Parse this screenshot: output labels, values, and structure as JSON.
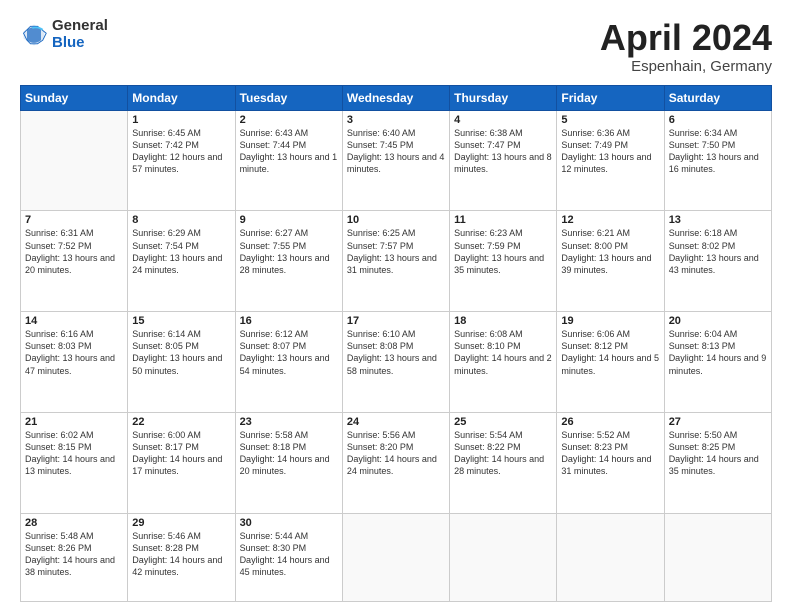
{
  "logo": {
    "general": "General",
    "blue": "Blue"
  },
  "header": {
    "title": "April 2024",
    "subtitle": "Espenhain, Germany"
  },
  "weekdays": [
    "Sunday",
    "Monday",
    "Tuesday",
    "Wednesday",
    "Thursday",
    "Friday",
    "Saturday"
  ],
  "weeks": [
    [
      {
        "day": "",
        "sunrise": "",
        "sunset": "",
        "daylight": ""
      },
      {
        "day": "1",
        "sunrise": "Sunrise: 6:45 AM",
        "sunset": "Sunset: 7:42 PM",
        "daylight": "Daylight: 12 hours and 57 minutes."
      },
      {
        "day": "2",
        "sunrise": "Sunrise: 6:43 AM",
        "sunset": "Sunset: 7:44 PM",
        "daylight": "Daylight: 13 hours and 1 minute."
      },
      {
        "day": "3",
        "sunrise": "Sunrise: 6:40 AM",
        "sunset": "Sunset: 7:45 PM",
        "daylight": "Daylight: 13 hours and 4 minutes."
      },
      {
        "day": "4",
        "sunrise": "Sunrise: 6:38 AM",
        "sunset": "Sunset: 7:47 PM",
        "daylight": "Daylight: 13 hours and 8 minutes."
      },
      {
        "day": "5",
        "sunrise": "Sunrise: 6:36 AM",
        "sunset": "Sunset: 7:49 PM",
        "daylight": "Daylight: 13 hours and 12 minutes."
      },
      {
        "day": "6",
        "sunrise": "Sunrise: 6:34 AM",
        "sunset": "Sunset: 7:50 PM",
        "daylight": "Daylight: 13 hours and 16 minutes."
      }
    ],
    [
      {
        "day": "7",
        "sunrise": "Sunrise: 6:31 AM",
        "sunset": "Sunset: 7:52 PM",
        "daylight": "Daylight: 13 hours and 20 minutes."
      },
      {
        "day": "8",
        "sunrise": "Sunrise: 6:29 AM",
        "sunset": "Sunset: 7:54 PM",
        "daylight": "Daylight: 13 hours and 24 minutes."
      },
      {
        "day": "9",
        "sunrise": "Sunrise: 6:27 AM",
        "sunset": "Sunset: 7:55 PM",
        "daylight": "Daylight: 13 hours and 28 minutes."
      },
      {
        "day": "10",
        "sunrise": "Sunrise: 6:25 AM",
        "sunset": "Sunset: 7:57 PM",
        "daylight": "Daylight: 13 hours and 31 minutes."
      },
      {
        "day": "11",
        "sunrise": "Sunrise: 6:23 AM",
        "sunset": "Sunset: 7:59 PM",
        "daylight": "Daylight: 13 hours and 35 minutes."
      },
      {
        "day": "12",
        "sunrise": "Sunrise: 6:21 AM",
        "sunset": "Sunset: 8:00 PM",
        "daylight": "Daylight: 13 hours and 39 minutes."
      },
      {
        "day": "13",
        "sunrise": "Sunrise: 6:18 AM",
        "sunset": "Sunset: 8:02 PM",
        "daylight": "Daylight: 13 hours and 43 minutes."
      }
    ],
    [
      {
        "day": "14",
        "sunrise": "Sunrise: 6:16 AM",
        "sunset": "Sunset: 8:03 PM",
        "daylight": "Daylight: 13 hours and 47 minutes."
      },
      {
        "day": "15",
        "sunrise": "Sunrise: 6:14 AM",
        "sunset": "Sunset: 8:05 PM",
        "daylight": "Daylight: 13 hours and 50 minutes."
      },
      {
        "day": "16",
        "sunrise": "Sunrise: 6:12 AM",
        "sunset": "Sunset: 8:07 PM",
        "daylight": "Daylight: 13 hours and 54 minutes."
      },
      {
        "day": "17",
        "sunrise": "Sunrise: 6:10 AM",
        "sunset": "Sunset: 8:08 PM",
        "daylight": "Daylight: 13 hours and 58 minutes."
      },
      {
        "day": "18",
        "sunrise": "Sunrise: 6:08 AM",
        "sunset": "Sunset: 8:10 PM",
        "daylight": "Daylight: 14 hours and 2 minutes."
      },
      {
        "day": "19",
        "sunrise": "Sunrise: 6:06 AM",
        "sunset": "Sunset: 8:12 PM",
        "daylight": "Daylight: 14 hours and 5 minutes."
      },
      {
        "day": "20",
        "sunrise": "Sunrise: 6:04 AM",
        "sunset": "Sunset: 8:13 PM",
        "daylight": "Daylight: 14 hours and 9 minutes."
      }
    ],
    [
      {
        "day": "21",
        "sunrise": "Sunrise: 6:02 AM",
        "sunset": "Sunset: 8:15 PM",
        "daylight": "Daylight: 14 hours and 13 minutes."
      },
      {
        "day": "22",
        "sunrise": "Sunrise: 6:00 AM",
        "sunset": "Sunset: 8:17 PM",
        "daylight": "Daylight: 14 hours and 17 minutes."
      },
      {
        "day": "23",
        "sunrise": "Sunrise: 5:58 AM",
        "sunset": "Sunset: 8:18 PM",
        "daylight": "Daylight: 14 hours and 20 minutes."
      },
      {
        "day": "24",
        "sunrise": "Sunrise: 5:56 AM",
        "sunset": "Sunset: 8:20 PM",
        "daylight": "Daylight: 14 hours and 24 minutes."
      },
      {
        "day": "25",
        "sunrise": "Sunrise: 5:54 AM",
        "sunset": "Sunset: 8:22 PM",
        "daylight": "Daylight: 14 hours and 28 minutes."
      },
      {
        "day": "26",
        "sunrise": "Sunrise: 5:52 AM",
        "sunset": "Sunset: 8:23 PM",
        "daylight": "Daylight: 14 hours and 31 minutes."
      },
      {
        "day": "27",
        "sunrise": "Sunrise: 5:50 AM",
        "sunset": "Sunset: 8:25 PM",
        "daylight": "Daylight: 14 hours and 35 minutes."
      }
    ],
    [
      {
        "day": "28",
        "sunrise": "Sunrise: 5:48 AM",
        "sunset": "Sunset: 8:26 PM",
        "daylight": "Daylight: 14 hours and 38 minutes."
      },
      {
        "day": "29",
        "sunrise": "Sunrise: 5:46 AM",
        "sunset": "Sunset: 8:28 PM",
        "daylight": "Daylight: 14 hours and 42 minutes."
      },
      {
        "day": "30",
        "sunrise": "Sunrise: 5:44 AM",
        "sunset": "Sunset: 8:30 PM",
        "daylight": "Daylight: 14 hours and 45 minutes."
      },
      {
        "day": "",
        "sunrise": "",
        "sunset": "",
        "daylight": ""
      },
      {
        "day": "",
        "sunrise": "",
        "sunset": "",
        "daylight": ""
      },
      {
        "day": "",
        "sunrise": "",
        "sunset": "",
        "daylight": ""
      },
      {
        "day": "",
        "sunrise": "",
        "sunset": "",
        "daylight": ""
      }
    ]
  ]
}
